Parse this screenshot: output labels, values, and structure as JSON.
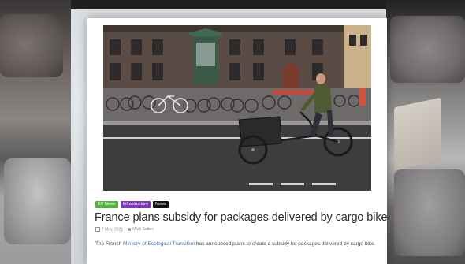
{
  "article": {
    "tags": [
      {
        "label": "EV News",
        "color": "#4fb33a"
      },
      {
        "label": "Infrastructure",
        "color": "#7a38b8"
      },
      {
        "label": "News",
        "color": "#111111"
      }
    ],
    "title": "France plans subsidy for packages delivered by cargo bike",
    "date": "7 May, 2021",
    "author": "Mark Sutton",
    "body_prefix": "The French ",
    "body_link": "Ministry of Ecological Transition",
    "body_suffix": " has announced plans to create a subsidy for packages delivered by cargo bike.",
    "image_icon": "cargo-bike-street-photo"
  },
  "colors": {
    "link": "#3577b8",
    "headline": "#2a2a2a",
    "meta": "#8a8a8a"
  }
}
